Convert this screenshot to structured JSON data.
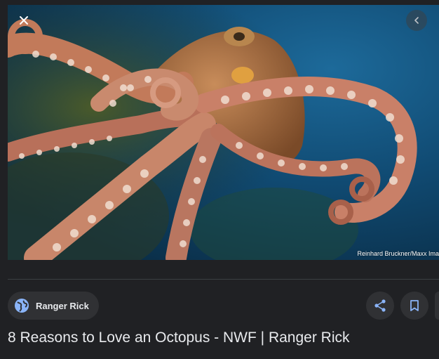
{
  "image": {
    "alt": "Octopus photo",
    "credit": "Reinhard Bruckner/Maxx Ima"
  },
  "controls": {
    "close_icon": "close-icon",
    "prev_icon": "chevron-left-icon"
  },
  "source": {
    "name": "Ranger Rick",
    "icon": "globe-icon"
  },
  "actions": {
    "share_icon": "share-icon",
    "save_icon": "bookmark-icon"
  },
  "title": "8 Reasons to Love an Octopus - NWF | Ranger Rick",
  "colors": {
    "background": "#202124",
    "chip": "#303134",
    "text": "#e8eaed",
    "accent": "#8ab4f8"
  }
}
